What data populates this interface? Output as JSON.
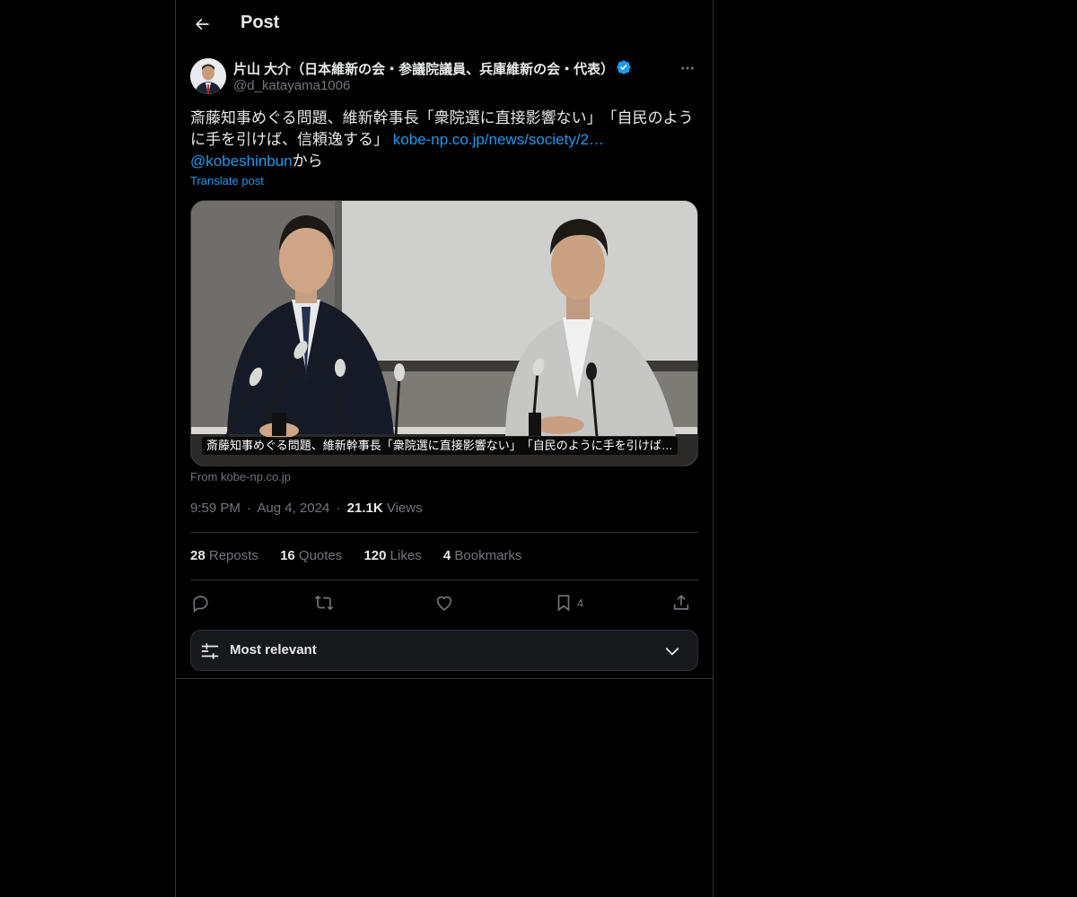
{
  "header": {
    "title": "Post"
  },
  "author": {
    "display_name": "片山 大介（日本維新の会・参議院議員、兵庫維新の会・代表）",
    "handle": "@d_katayama1006",
    "verified": true
  },
  "tweet": {
    "text_part1": "斎藤知事めぐる問題、維新幹事長「衆院選に直接影響ない」　「自民のように手を引けば、信頼逸する」 ",
    "link_text": "kobe-np.co.jp/news/society/2…",
    "mention": "@kobeshinbun",
    "text_part2": "から",
    "translate_label": "Translate post"
  },
  "media": {
    "caption": "斎藤知事めぐる問題、維新幹事長「衆院選に直接影響ない」　「自民のように手を引けば…",
    "source": "From kobe-np.co.jp"
  },
  "meta": {
    "time": "9:59 PM",
    "date": "Aug 4, 2024",
    "views_count": "21.1K",
    "views_label": "Views",
    "separator": "·"
  },
  "stats": [
    {
      "count": "28",
      "label": "Reposts"
    },
    {
      "count": "16",
      "label": "Quotes"
    },
    {
      "count": "120",
      "label": "Likes"
    },
    {
      "count": "4",
      "label": "Bookmarks"
    }
  ],
  "actions": {
    "reply_icon": "reply-icon",
    "repost_icon": "repost-icon",
    "like_icon": "like-icon",
    "bookmark_icon": "bookmark-icon",
    "bookmark_count": "4",
    "share_icon": "share-icon"
  },
  "sort": {
    "label": "Most relevant"
  },
  "colors": {
    "background": "#000000",
    "text": "#e7e9ea",
    "muted": "#71767b",
    "accent": "#1d9bf0",
    "border": "#2f3336"
  }
}
